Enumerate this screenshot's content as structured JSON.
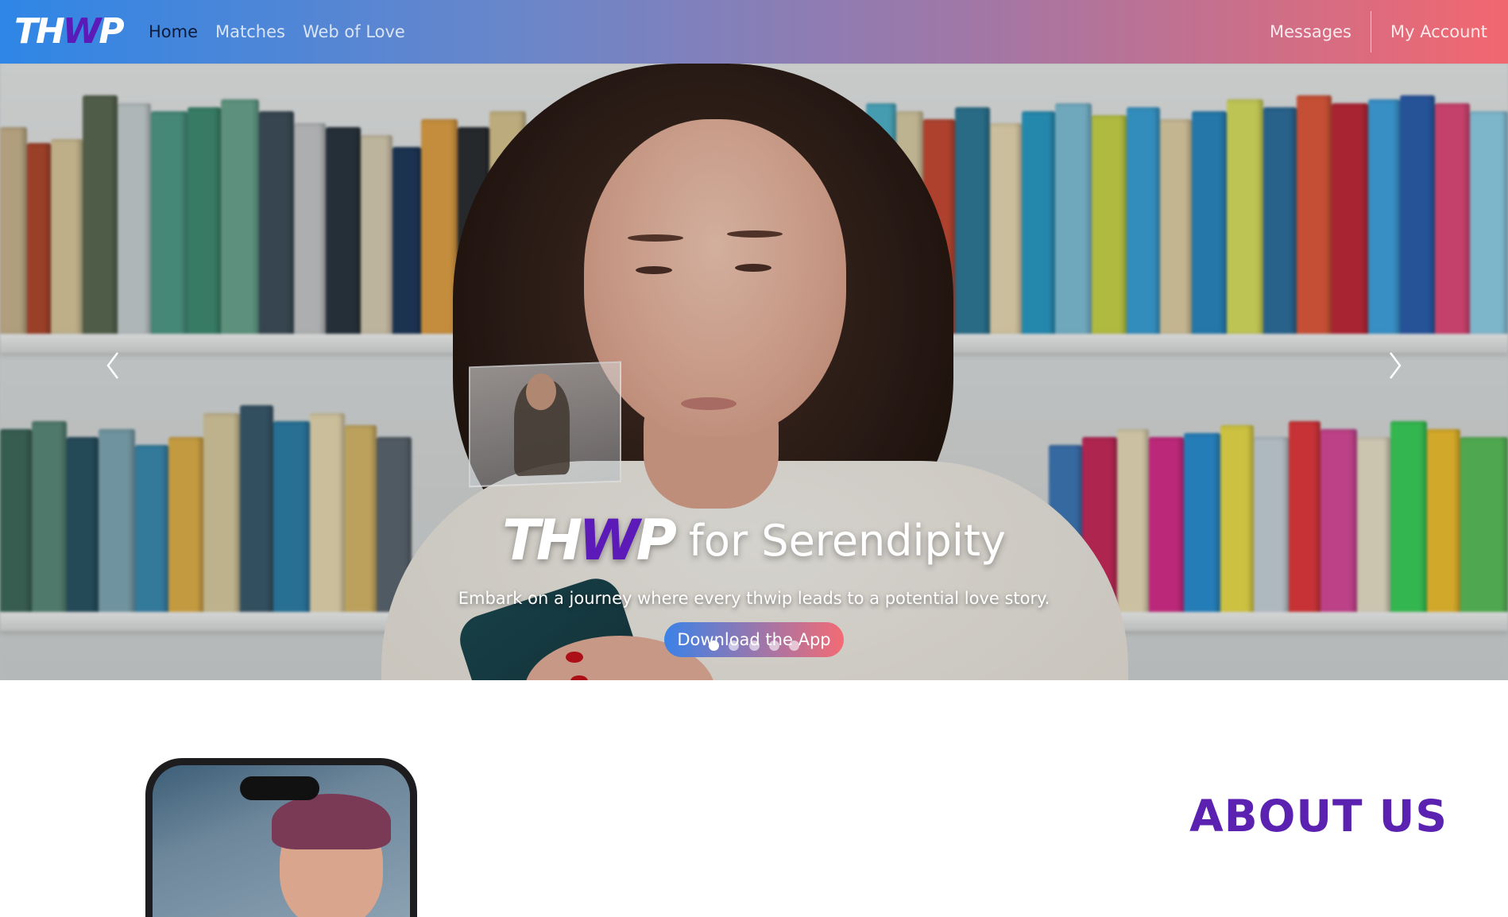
{
  "navbar": {
    "logo": {
      "part_white": "TH",
      "part_purple": "W",
      "part_white2": "P"
    },
    "left_links": [
      "Home",
      "Matches",
      "Web of Love"
    ],
    "active_link": "Home",
    "right_links": [
      "Messages",
      "My Account"
    ],
    "gradient_colors": [
      "#2f86e6",
      "#f2676f"
    ]
  },
  "hero": {
    "title_logo": {
      "part_white": "TH",
      "part_purple": "W",
      "part_white2": "P"
    },
    "title": "for Serendipity",
    "subtitle": "Embark on a journey where every thwip leads to a potential love story.",
    "cta_label": "Download the App",
    "slide_count": 5,
    "active_slide": 1,
    "prev_icon": "chevron-left-icon",
    "next_icon": "chevron-right-icon"
  },
  "about": {
    "heading": "ABOUT US",
    "heading_color": "#5b21b0"
  }
}
